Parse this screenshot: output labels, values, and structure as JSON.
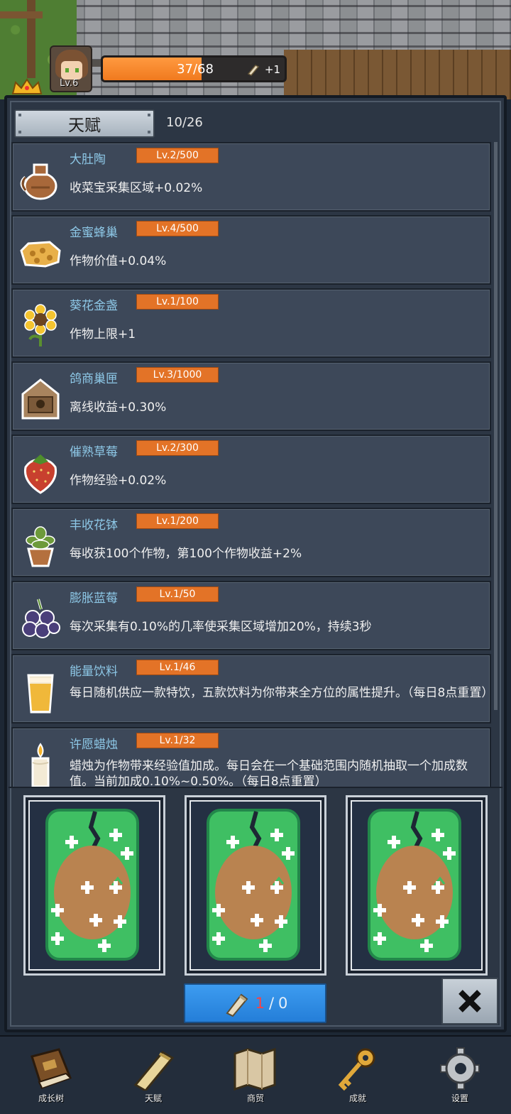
{
  "player": {
    "level_label": "Lv.6",
    "xp_text": "37/68",
    "xp_fraction": 0.544,
    "scroll_bonus": "+1"
  },
  "talent_panel": {
    "tab_label": "天赋",
    "progress": "10/26",
    "items": [
      {
        "name": "大肚陶",
        "level": "Lv.2/500",
        "desc": "收菜宝采集区域+0.02%",
        "icon": "pottery-jug-icon"
      },
      {
        "name": "金蜜蜂巢",
        "level": "Lv.4/500",
        "desc": "作物价值+0.04%",
        "icon": "honeycomb-icon"
      },
      {
        "name": "葵花金盏",
        "level": "Lv.1/100",
        "desc": "作物上限+1",
        "icon": "sunflower-icon"
      },
      {
        "name": "鸽商巢匣",
        "level": "Lv.3/1000",
        "desc": "离线收益+0.30%",
        "icon": "birdhouse-icon"
      },
      {
        "name": "催熟草莓",
        "level": "Lv.2/300",
        "desc": "作物经验+0.02%",
        "icon": "strawberry-icon"
      },
      {
        "name": "丰收花钵",
        "level": "Lv.1/200",
        "desc": "每收获100个作物，第100个作物收益+2%",
        "icon": "flower-pot-icon"
      },
      {
        "name": "膨胀蓝莓",
        "level": "Lv.1/50",
        "desc": "每次采集有0.10%的几率使采集区域增加20%，持续3秒",
        "icon": "blueberry-icon"
      },
      {
        "name": "能量饮料",
        "level": "Lv.1/46",
        "desc": "每日随机供应一款特饮，五款饮料为你带来全方位的属性提升。（每日8点重置）",
        "icon": "energy-drink-icon"
      },
      {
        "name": "许愿蜡烛",
        "level": "Lv.1/32",
        "desc": "蜡烛为作物带来经验值加成。每日会在一个基础范围内随机抽取一个加成数值。当前加成0.10%~0.50%。（每日8点重置）",
        "icon": "candle-icon"
      }
    ]
  },
  "draw": {
    "cards": [
      {
        "icon": "talent-card-back-icon"
      },
      {
        "icon": "talent-card-back-icon"
      },
      {
        "icon": "talent-card-back-icon"
      }
    ],
    "scroll_count": "1",
    "separator": "/",
    "scroll_total": "0"
  },
  "nav": {
    "items": [
      {
        "label": "成长树",
        "icon": "book-icon"
      },
      {
        "label": "天赋",
        "icon": "scroll-icon"
      },
      {
        "label": "商贸",
        "icon": "map-icon"
      },
      {
        "label": "成就",
        "icon": "key-icon"
      },
      {
        "label": "设置",
        "icon": "gear-icon"
      }
    ]
  },
  "colors": {
    "accent_orange": "#e37327",
    "name_blue": "#8dc7e6",
    "button_blue": "#2f8ce6",
    "card_green": "#3fbf63"
  }
}
